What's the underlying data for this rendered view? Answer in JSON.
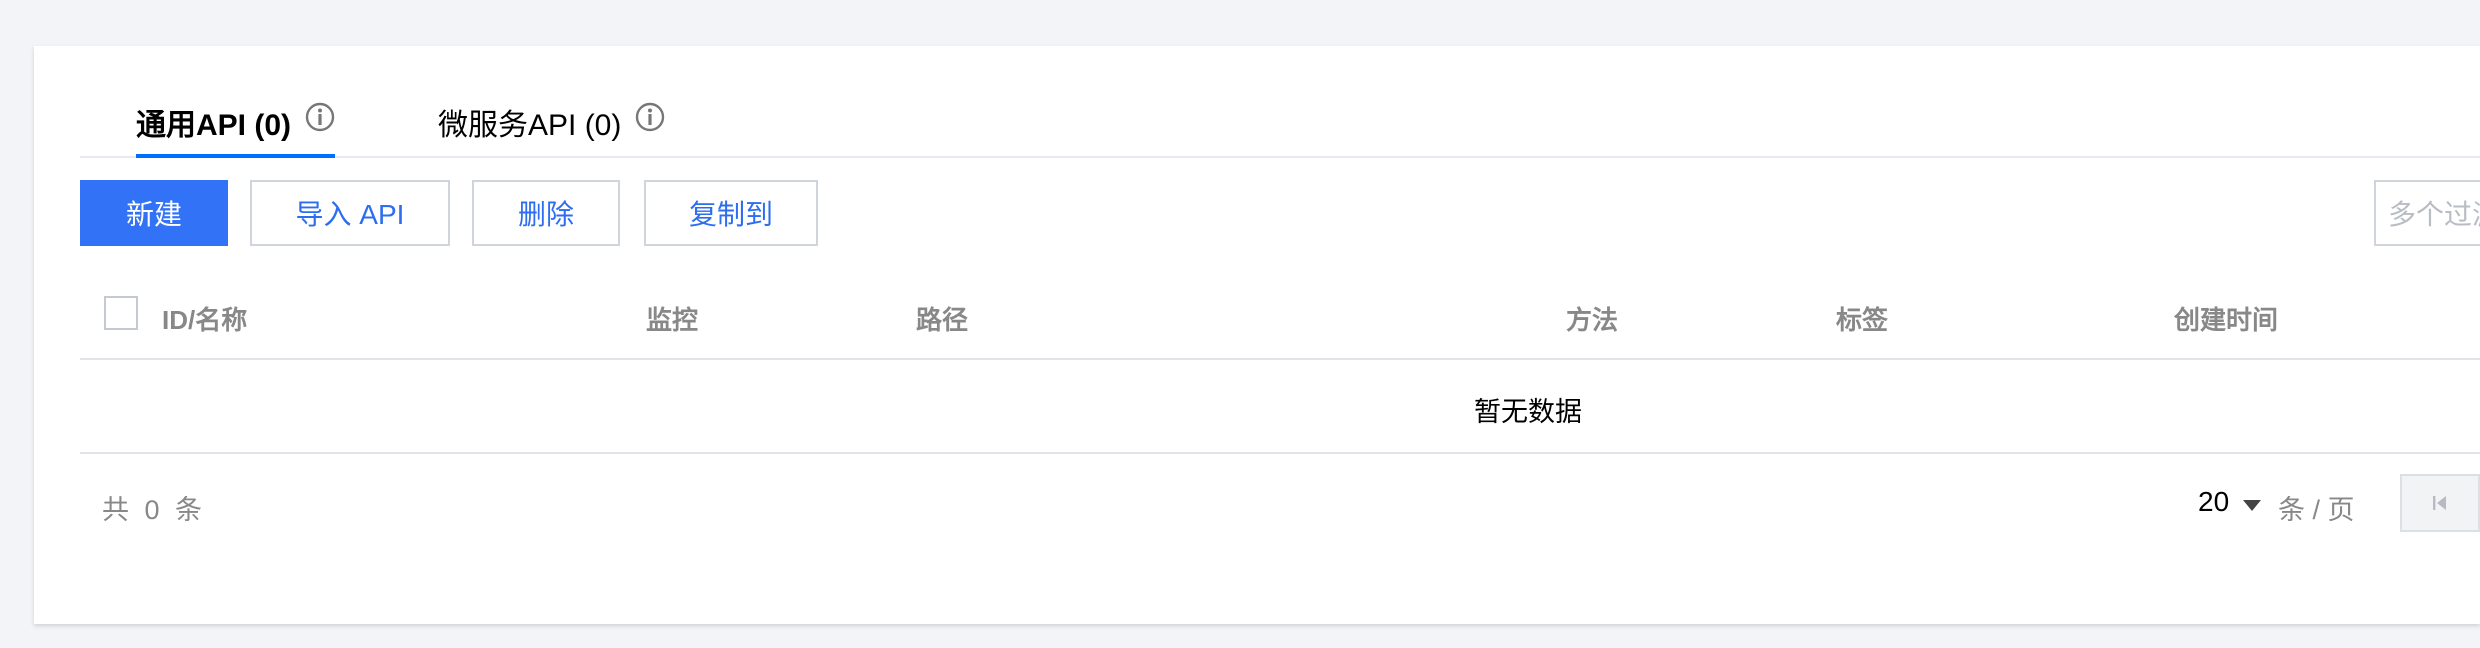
{
  "tabs": [
    {
      "label": "通用API (0)",
      "active": true,
      "icon": "info-icon"
    },
    {
      "label": "微服务API (0)",
      "active": false,
      "icon": "info-icon"
    }
  ],
  "toolbar": {
    "new_label": "新建",
    "import_label": "导入 API",
    "delete_label": "删除",
    "copy_label": "复制到",
    "search_placeholder": "多个过滤"
  },
  "table": {
    "columns": [
      "ID/名称",
      "监控",
      "路径",
      "方法",
      "标签",
      "创建时间"
    ],
    "empty_text": "暂无数据"
  },
  "footer": {
    "total": "共 0 条",
    "page_size": "20",
    "per_page_label": "条 / 页"
  },
  "colors": {
    "primary": "#3172f6",
    "link": "#2d6ef0",
    "tab_underline": "#006eff",
    "background": "#f3f4f7"
  }
}
